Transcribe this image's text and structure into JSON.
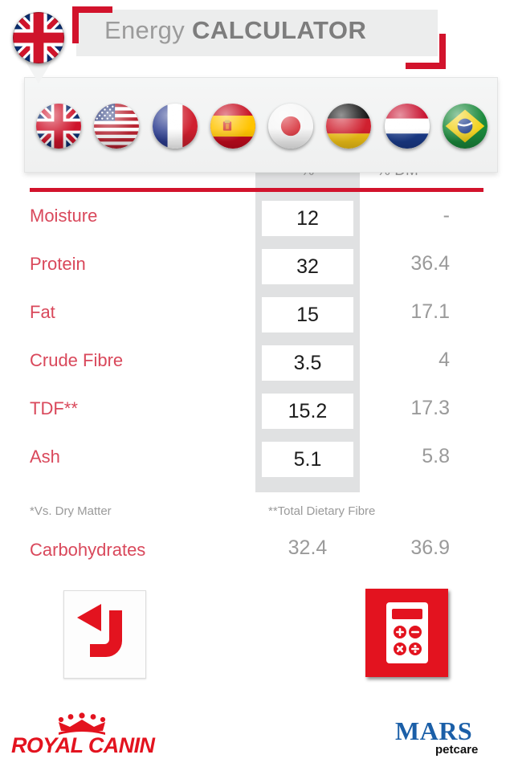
{
  "header": {
    "title_light": "Energy",
    "title_bold": "CALCULATOR",
    "selected_flag": "uk-flag-icon",
    "accent_color": "#d2132c",
    "title_color": "#7d7d7d"
  },
  "language_panel": {
    "flags": [
      {
        "name": "uk-flag-icon",
        "label": "United Kingdom"
      },
      {
        "name": "usa-flag-icon",
        "label": "United States"
      },
      {
        "name": "france-flag-icon",
        "label": "France"
      },
      {
        "name": "spain-flag-icon",
        "label": "Spain"
      },
      {
        "name": "japan-flag-icon",
        "label": "Japan"
      },
      {
        "name": "germany-flag-icon",
        "label": "Germany"
      },
      {
        "name": "netherlands-flag-icon",
        "label": "Netherlands"
      },
      {
        "name": "brazil-flag-icon",
        "label": "Brazil"
      }
    ]
  },
  "table": {
    "headers": {
      "percent": "%",
      "dry_matter": "% DM"
    },
    "rows": [
      {
        "label": "Moisture",
        "value": "12",
        "dm": "-"
      },
      {
        "label": "Protein",
        "value": "32",
        "dm": "36.4"
      },
      {
        "label": "Fat",
        "value": "15",
        "dm": "17.1"
      },
      {
        "label": "Crude Fibre",
        "value": "3.5",
        "dm": "4"
      },
      {
        "label": "TDF**",
        "value": "15.2",
        "dm": "17.3"
      },
      {
        "label": "Ash",
        "value": "5.1",
        "dm": "5.8"
      }
    ],
    "label_color": "#d9485b",
    "value_color": "#9a9a9a"
  },
  "footnotes": {
    "left": "*Vs. Dry Matter",
    "right": "**Total Dietary Fibre"
  },
  "carbohydrates": {
    "label": "Carbohydrates",
    "percent": "32.4",
    "dry_matter": "36.9"
  },
  "actions": {
    "back": {
      "name": "back-arrow-icon",
      "label": "Back"
    },
    "calculate": {
      "name": "calculator-icon",
      "label": "Calculate"
    }
  },
  "branding": {
    "royal_canin": "ROYAL CANIN",
    "mars": "MARS",
    "mars_sub": "petcare",
    "mars_color": "#1b5fa8"
  }
}
